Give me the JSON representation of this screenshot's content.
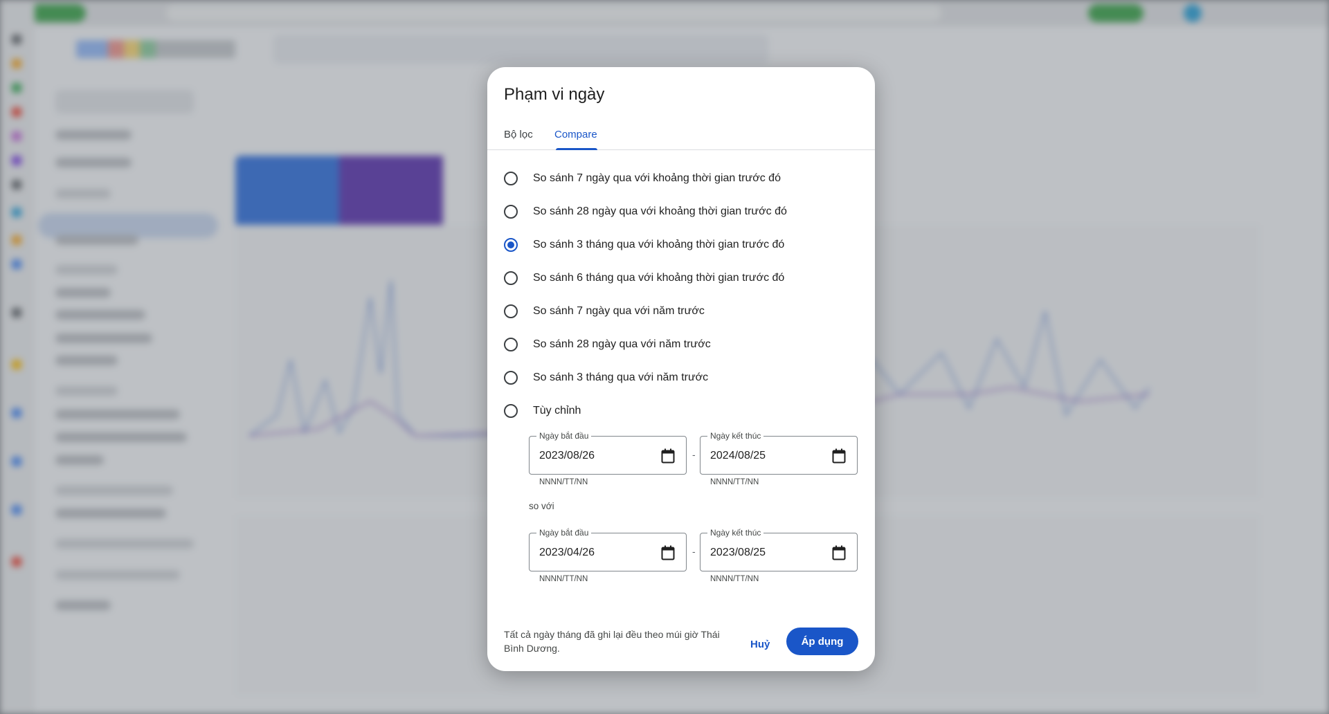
{
  "dialog": {
    "title": "Phạm vi ngày",
    "tabs": [
      {
        "label": "Bộ lọc",
        "active": false
      },
      {
        "label": "Compare",
        "active": true
      }
    ],
    "options": [
      {
        "label": "So sánh 7 ngày qua với khoảng thời gian trước đó",
        "checked": false
      },
      {
        "label": "So sánh 28 ngày qua với khoảng thời gian trước đó",
        "checked": false
      },
      {
        "label": "So sánh 3 tháng qua với khoảng thời gian trước đó",
        "checked": true
      },
      {
        "label": "So sánh 6 tháng qua với khoảng thời gian trước đó",
        "checked": false
      },
      {
        "label": "So sánh 7 ngày qua với năm trước",
        "checked": false
      },
      {
        "label": "So sánh 28 ngày qua với năm trước",
        "checked": false
      },
      {
        "label": "So sánh 3 tháng qua với năm trước",
        "checked": false
      },
      {
        "label": "Tùy chỉnh",
        "checked": false
      }
    ],
    "range1": {
      "start": {
        "label": "Ngày bắt đầu",
        "value": "2023/08/26",
        "hint": "NNNN/TT/NN"
      },
      "end": {
        "label": "Ngày kết thúc",
        "value": "2024/08/25",
        "hint": "NNNN/TT/NN"
      }
    },
    "separator": "-",
    "compare_text": "so với",
    "range2": {
      "start": {
        "label": "Ngày bắt đầu",
        "value": "2023/04/26",
        "hint": "NNNN/TT/NN"
      },
      "end": {
        "label": "Ngày kết thúc",
        "value": "2023/08/25",
        "hint": "NNNN/TT/NN"
      }
    },
    "footer_note": "Tất cả ngày tháng đã ghi lại đều theo múi giờ Thái Bình Dương.",
    "cancel_label": "Huỷ",
    "apply_label": "Áp dụng"
  },
  "colors": {
    "accent": "#1a56c8",
    "clicks_card": "#2f6fde",
    "impressions_card": "#5a32b0"
  },
  "icons": {
    "calendar": "calendar-icon"
  }
}
